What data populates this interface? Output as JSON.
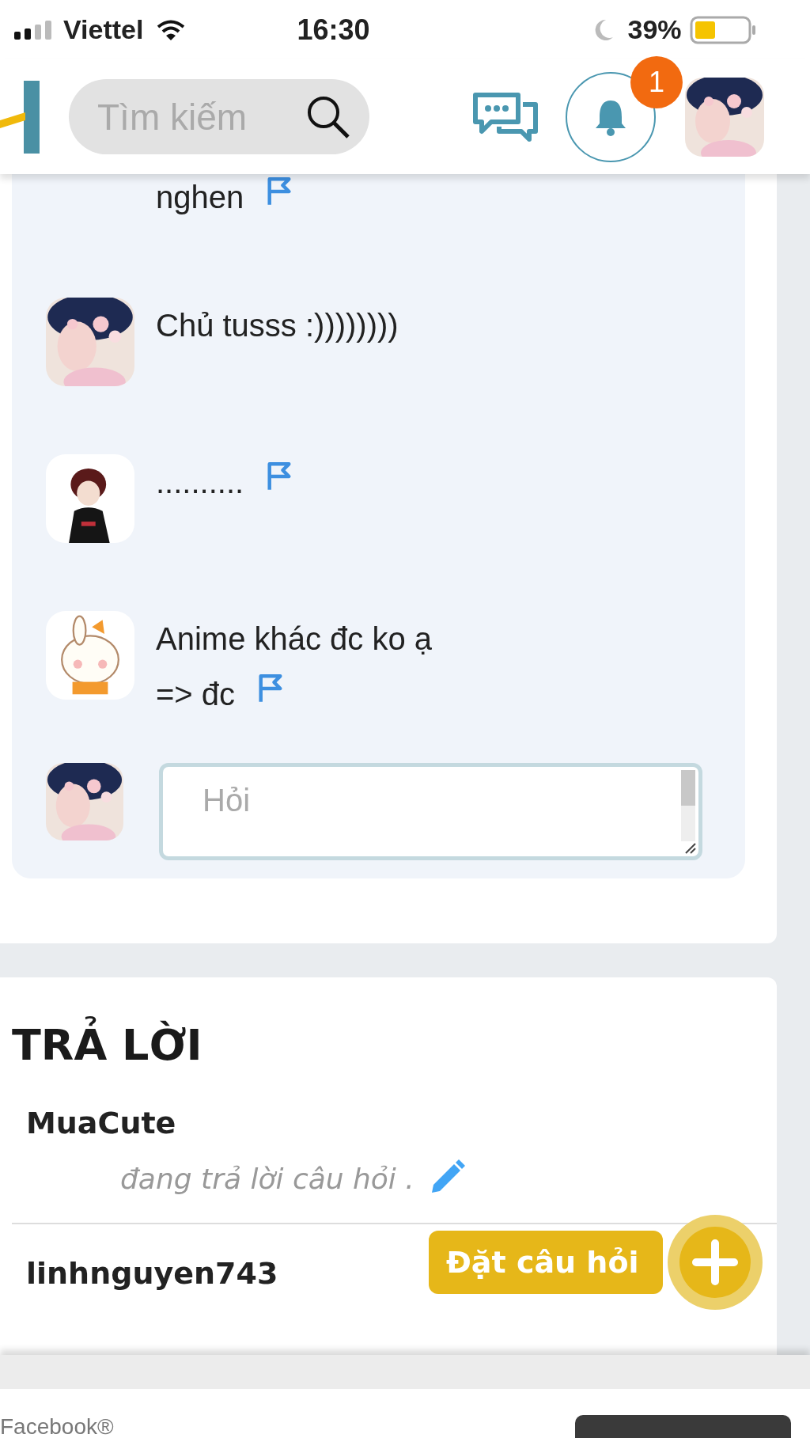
{
  "status_bar": {
    "carrier": "Viettel",
    "time": "16:30",
    "battery": "39%"
  },
  "header": {
    "search": {
      "placeholder": "Tìm kiếm"
    },
    "notifications": {
      "badge": "1"
    }
  },
  "comments": [
    {
      "has_avatar": false,
      "lines": [
        "nghen"
      ],
      "flag": true
    },
    {
      "has_avatar": true,
      "lines": [
        "Chủ tusss :))))))))"
      ],
      "flag": false
    },
    {
      "has_avatar": true,
      "lines": [
        ".........."
      ],
      "flag": true
    },
    {
      "has_avatar": true,
      "lines": [
        "Anime khác  đc ko ạ",
        "=> đc"
      ],
      "flag": true
    }
  ],
  "comment_box": {
    "placeholder": "Hỏi"
  },
  "answers": {
    "title": "TRẢ LỜI",
    "items": [
      {
        "user": "MuaCute",
        "status": "đang trả lời câu hỏi .",
        "editing": true
      },
      {
        "user": "linhnguyen743"
      }
    ]
  },
  "ask_button": {
    "label": "Đặt câu hỏi"
  },
  "footer": {
    "brand": "Facebook®"
  }
}
